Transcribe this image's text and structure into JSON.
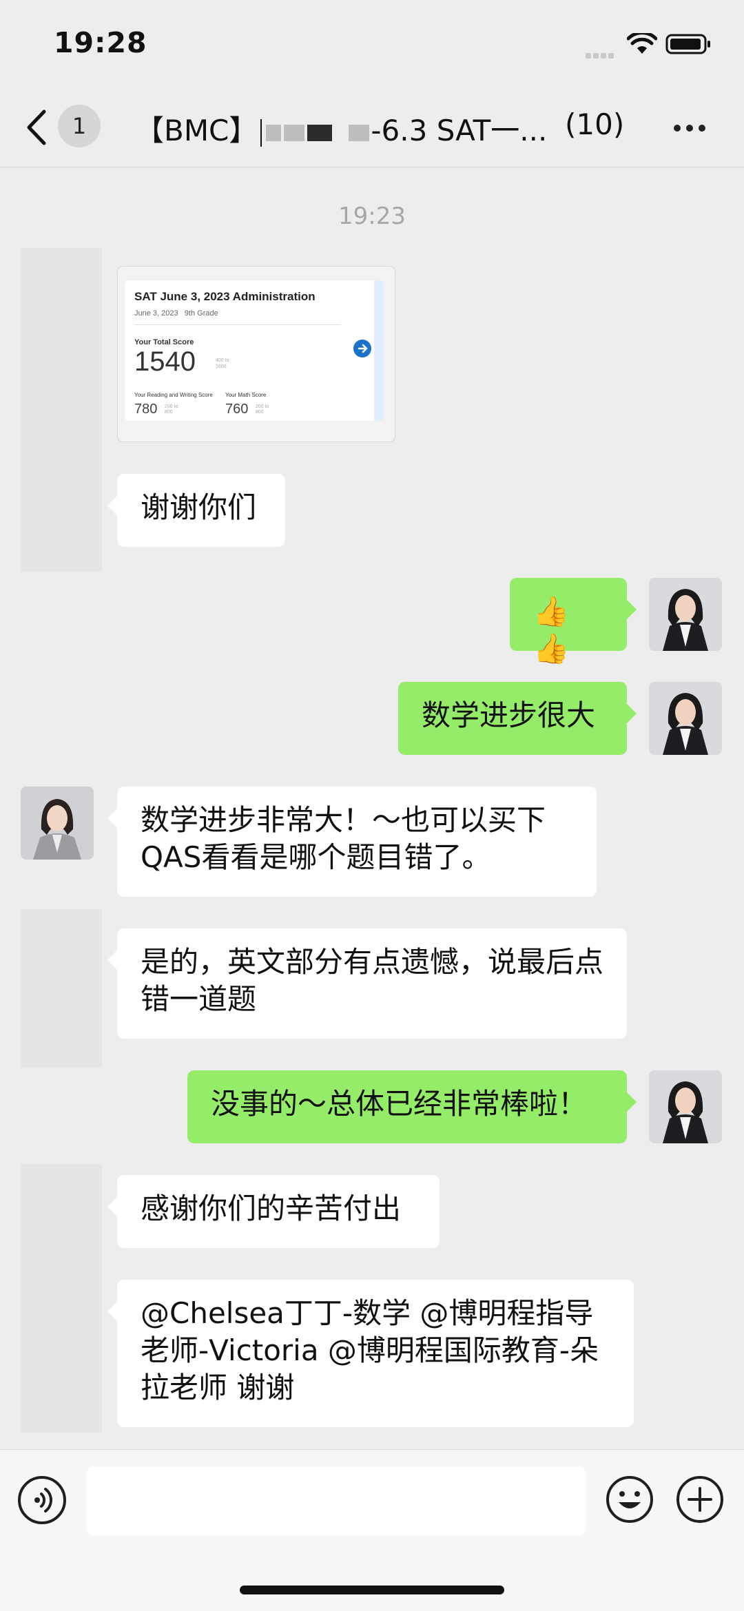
{
  "status_bar": {
    "time": "19:28"
  },
  "header": {
    "unread_count": "1",
    "title_prefix": "【BMC】",
    "title_suffix": "-6.3 SAT一...",
    "member_count": "(10)"
  },
  "timestamp": "19:23",
  "score_card": {
    "title": "SAT June 3, 2023 Administration",
    "date": "June 3, 2023",
    "grade": "9th Grade",
    "total_label": "Your Total Score",
    "total": "1540",
    "total_range": "400 to 1600",
    "rw_label": "Your Reading and Writing Score",
    "rw_score": "780",
    "rw_range": "200 to 800",
    "math_label": "Your Math Score",
    "math_score": "760",
    "math_range": "200 to 800"
  },
  "messages": [
    {
      "side": "in",
      "text": "谢谢你们"
    },
    {
      "side": "out",
      "text": "👍👍"
    },
    {
      "side": "out",
      "text": "数学进步很大"
    },
    {
      "side": "in",
      "text": "数学进步非常大！～也可以买下QAS看看是哪个题目错了。"
    },
    {
      "side": "in",
      "text": "是的，英文部分有点遗憾，说最后点错一道题"
    },
    {
      "side": "out",
      "text": "没事的～总体已经非常棒啦！"
    },
    {
      "side": "in",
      "text": "感谢你们的辛苦付出"
    },
    {
      "side": "in",
      "text": "@Chelsea丁丁-数学 @博明程指导老师-Victoria @博明程国际教育-朵拉老师 谢谢"
    }
  ],
  "input": {
    "placeholder": ""
  },
  "colors": {
    "bg": "#ededed",
    "out_bubble": "#95ec69",
    "in_bubble": "#ffffff"
  }
}
